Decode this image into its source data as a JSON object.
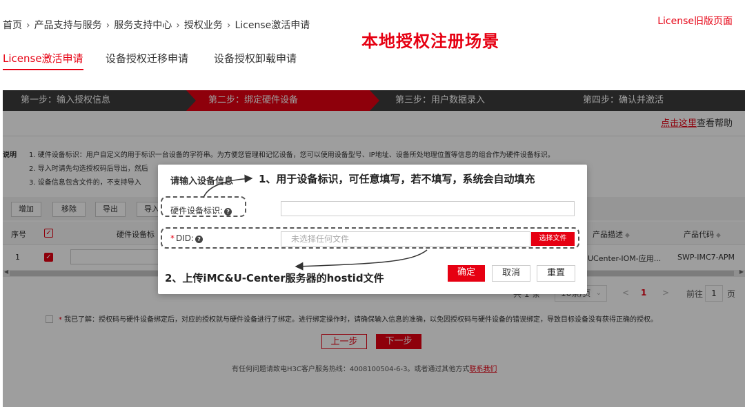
{
  "breadcrumb": [
    "首页",
    "产品支持与服务",
    "服务支持中心",
    "授权业务",
    "License激活申请"
  ],
  "breadcrumb_sep": "›",
  "old_page_link": "License旧版页面",
  "scene_title": "本地授权注册场景",
  "tabs": [
    "License激活申请",
    "设备授权迁移申请",
    "设备授权卸载申请"
  ],
  "steps": [
    "第一步：输入授权信息",
    "第二步：绑定硬件设备",
    "第三步：用户数据录入",
    "第四步：确认并激活"
  ],
  "help": {
    "link": "点击这里",
    "text": "查看帮助"
  },
  "notes": {
    "label": "说明",
    "lines": [
      "1. 硬件设备标识：用户自定义的用于标识一台设备的字符串。为方便您管理和记忆设备，您可以使用设备型号、IP地址、设备所处地理位置等信息的组合作为硬件设备标识。",
      "2. 导入时请先勾选授权码后导出，然后",
      "3. 设备信息包含文件的，不支持导入"
    ]
  },
  "toolbar": [
    "增加",
    "移除",
    "导出",
    "导入"
  ],
  "table": {
    "headers": {
      "index": "序号",
      "device_id": "硬件设备标",
      "product_desc": "产品描述",
      "product_code": "产品代码"
    },
    "rows": [
      {
        "index": "1",
        "product_desc": "UCenter-IOM-应用...",
        "product_code": "SWP-IMC7-APM"
      }
    ]
  },
  "pagination": {
    "total": "共 1 条",
    "per_page": "10条/页",
    "prev": "<",
    "current": "1",
    "next": ">",
    "goto_label": "前往",
    "goto_value": "1",
    "page_unit": "页"
  },
  "agreement": "我已了解：授权码与硬件设备绑定后，对应的授权就与硬件设备进行了绑定。进行绑定操作时，请确保输入信息的准确，以免因授权码与硬件设备的错误绑定，导致目标设备没有获得正确的授权。",
  "nav": {
    "prev": "上一步",
    "next": "下一步"
  },
  "footer": {
    "text": "有任何问题请致电H3C客户服务热线：4008100504-6-3。或者通过其他方式",
    "link": "联系我们"
  },
  "dialog": {
    "title": "请输入设备信息",
    "device_label": "硬件设备标识:",
    "did_label": "DID:",
    "did_placeholder": "未选择任何文件",
    "choose_file": "选择文件",
    "confirm": "确定",
    "cancel": "取消",
    "reset": "重置"
  },
  "annotations": {
    "first": "1、用于设备标识，可任意填写，若不填写，系统会自动填充",
    "second": "2、上传iMC&U-Center服务器的hostid文件"
  },
  "colors": {
    "brand": "#e60012",
    "dark": "#3d3d3d"
  }
}
